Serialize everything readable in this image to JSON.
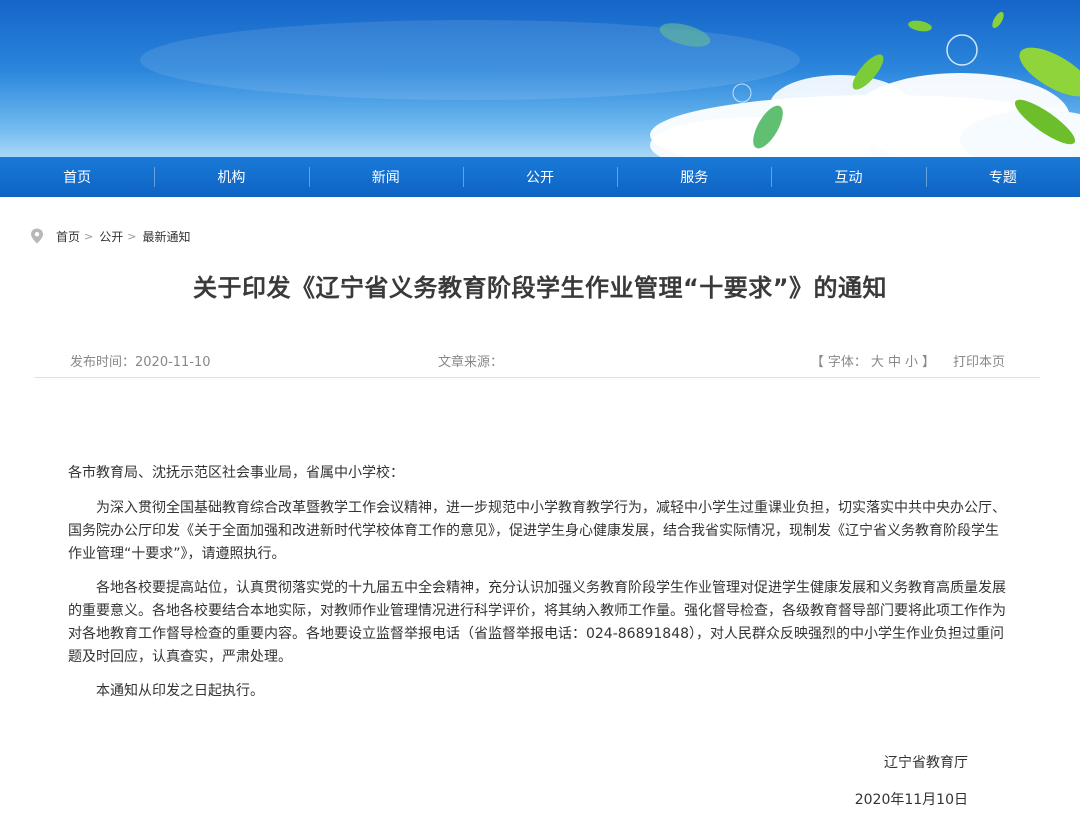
{
  "nav": {
    "items": [
      "首页",
      "机构",
      "新闻",
      "公开",
      "服务",
      "互动",
      "专题"
    ]
  },
  "breadcrumb": {
    "home": "首页",
    "section": "公开",
    "current": "最新通知",
    "separator": ">"
  },
  "article": {
    "title": "关于印发《辽宁省义务教育阶段学生作业管理“十要求”》的通知",
    "publish_label": "发布时间：",
    "publish_date": "2020-11-10",
    "source_label": "文章来源：",
    "source_value": "",
    "font_label": "【 字体：",
    "font_large": "大",
    "font_medium": "中",
    "font_small": "小",
    "font_close": "】",
    "print_label": "打印本页",
    "salutation": "各市教育局、沈抚示范区社会事业局，省属中小学校：",
    "paragraphs": [
      "为深入贯彻全国基础教育综合改革暨教学工作会议精神，进一步规范中小学教育教学行为，减轻中小学生过重课业负担，切实落实中共中央办公厅、国务院办公厅印发《关于全面加强和改进新时代学校体育工作的意见》，促进学生身心健康发展，结合我省实际情况，现制发《辽宁省义务教育阶段学生作业管理“十要求”》，请遵照执行。",
      "各地各校要提高站位，认真贯彻落实党的十九届五中全会精神，充分认识加强义务教育阶段学生作业管理对促进学生健康发展和义务教育高质量发展的重要意义。各地各校要结合本地实际，对教师作业管理情况进行科学评价，将其纳入教师工作量。强化督导检查，各级教育督导部门要将此项工作作为对各地教育工作督导检查的重要内容。各地要设立监督举报电话（省监督举报电话：024-86891848），对人民群众反映强烈的中小学生作业负担过重问题及时回应，认真查实，严肃处理。",
      "本通知从印发之日起执行。"
    ],
    "signature": "辽宁省教育厅",
    "sign_date": "2020年11月10日"
  },
  "colors": {
    "nav": "#0d63c2",
    "banner_top": "#1565c8"
  }
}
